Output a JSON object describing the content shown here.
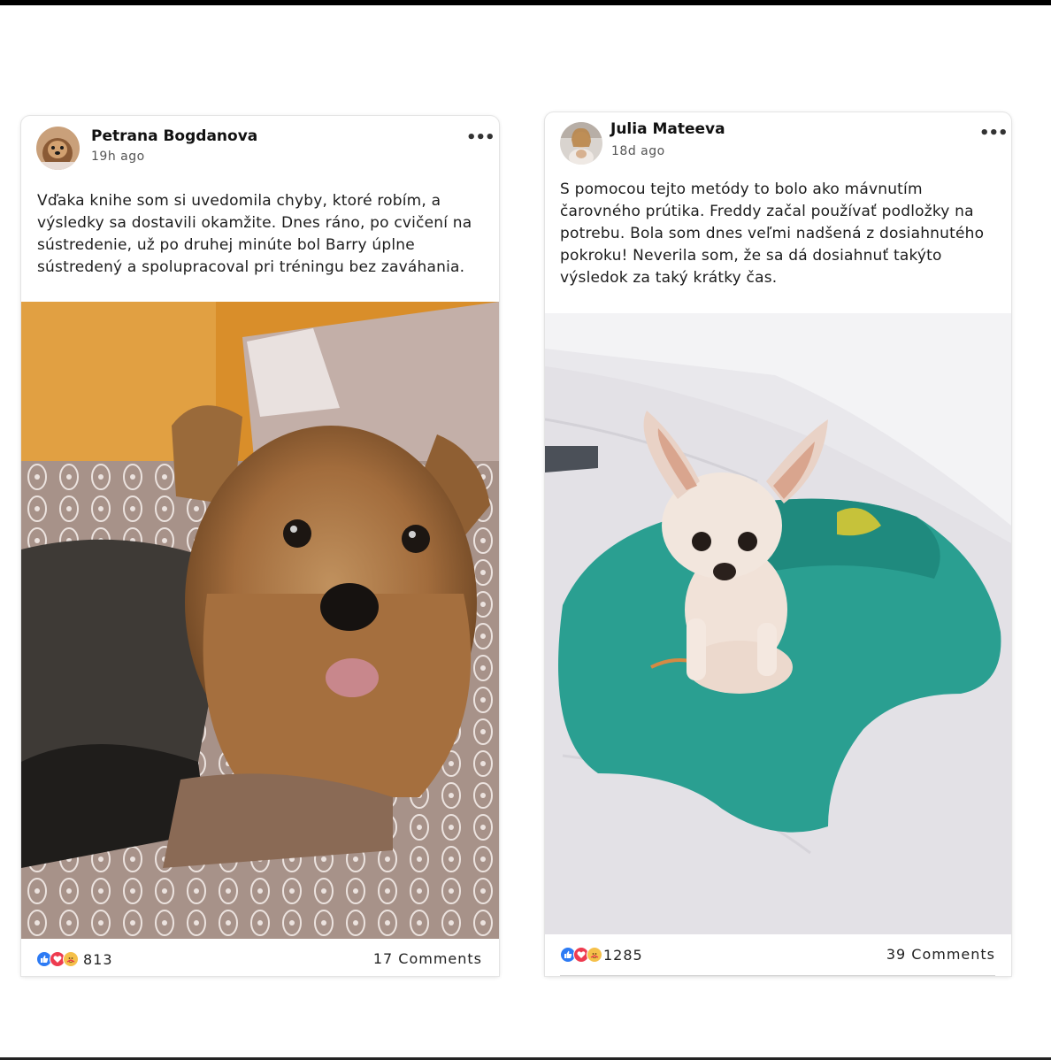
{
  "posts": [
    {
      "author": "Petrana Bogdanova",
      "time": "19h ago",
      "text": "Vďaka knihe som si uvedomila chyby, ktoré robím, a výsledky sa dostavili okamžite. Dnes ráno, po cvičení na sústredenie, už po druhej minúte bol Barry úplne sústredený a spolupracoval pri tréningu bez zaváhania.",
      "more_icon": "•••",
      "reaction_icons": [
        "like-icon",
        "love-icon",
        "care-icon"
      ],
      "reaction_count": "813",
      "comments": "17 Comments",
      "photo_subject": "yorkshire-terrier-on-bed"
    },
    {
      "author": "Julia Mateeva",
      "time": "18d ago",
      "text": "S pomocou tejto metódy to bolo ako mávnutím čarovného prútika. Freddy začal používať podložky na potrebu. Bola som dnes veľmi nadšená z dosiahnutého pokroku! Neverila som, že sa dá dosiahnuť takýto výsledok za taký krátky čas.",
      "more_icon": "•••",
      "reaction_icons": [
        "like-icon",
        "love-icon",
        "care-icon"
      ],
      "reaction_count": "1285",
      "comments": "39 Comments",
      "photo_subject": "chihuahua-on-teal-towel"
    }
  ],
  "colors": {
    "like": "#2d7bf4",
    "love": "#ee3b4f",
    "care": "#f5c04a",
    "page_background": "#ffffff"
  }
}
